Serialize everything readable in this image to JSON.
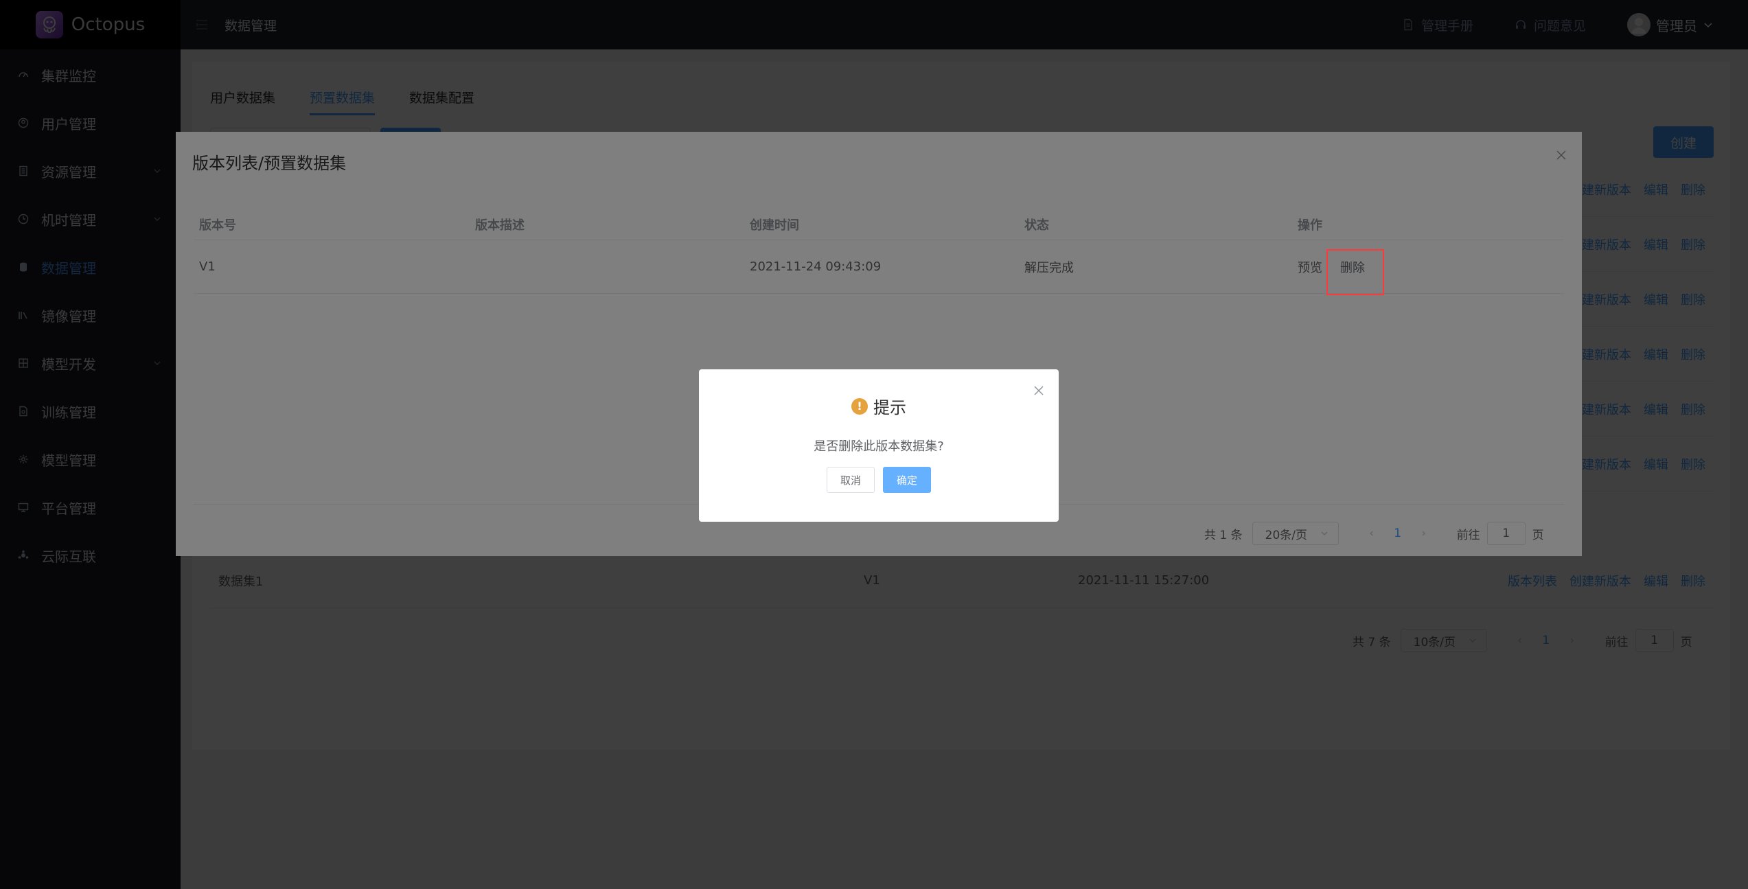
{
  "app": {
    "name": "Octopus"
  },
  "sidebar": {
    "items": [
      {
        "label": "集群监控",
        "icon": "dashboard-icon",
        "active": false,
        "has_children": false
      },
      {
        "label": "用户管理",
        "icon": "user-icon",
        "active": false,
        "has_children": false
      },
      {
        "label": "资源管理",
        "icon": "document-icon",
        "active": false,
        "has_children": true
      },
      {
        "label": "机时管理",
        "icon": "clock-icon",
        "active": false,
        "has_children": true
      },
      {
        "label": "数据管理",
        "icon": "database-icon",
        "active": true,
        "has_children": false
      },
      {
        "label": "镜像管理",
        "icon": "image-icon",
        "active": false,
        "has_children": false
      },
      {
        "label": "模型开发",
        "icon": "grid-icon",
        "active": false,
        "has_children": true
      },
      {
        "label": "训练管理",
        "icon": "file-icon",
        "active": false,
        "has_children": false
      },
      {
        "label": "模型管理",
        "icon": "gear-icon",
        "active": false,
        "has_children": false
      },
      {
        "label": "平台管理",
        "icon": "monitor-icon",
        "active": false,
        "has_children": false
      },
      {
        "label": "云际互联",
        "icon": "network-icon",
        "active": false,
        "has_children": false
      }
    ]
  },
  "header": {
    "breadcrumb": "数据管理",
    "manual": "管理手册",
    "feedback": "问题意见",
    "user": "管理员"
  },
  "main": {
    "tabs": [
      {
        "label": "用户数据集",
        "active": false
      },
      {
        "label": "预置数据集",
        "active": true
      },
      {
        "label": "数据集配置",
        "active": false
      }
    ],
    "create_button": "创建",
    "row_actions": {
      "versions": "版本列表",
      "create_version": "创建新版本",
      "edit": "编辑",
      "delete": "删除"
    },
    "visible_row": {
      "name": "数据集1",
      "version": "V1",
      "time": "2021-11-11 15:27:00"
    },
    "pagination": {
      "total": "共 7 条",
      "page_size": "10条/页",
      "page": "1",
      "goto_prefix": "前往",
      "goto_value": "1",
      "goto_suffix": "页"
    }
  },
  "version_dialog": {
    "title": "版本列表/预置数据集",
    "columns": [
      "版本号",
      "版本描述",
      "创建时间",
      "状态",
      "操作"
    ],
    "rows": [
      {
        "version": "V1",
        "desc": "",
        "time": "2021-11-24 09:43:09",
        "status": "解压完成",
        "preview": "预览",
        "delete": "删除"
      }
    ],
    "pagination": {
      "total": "共 1 条",
      "page_size": "20条/页",
      "page": "1",
      "goto_prefix": "前往",
      "goto_value": "1",
      "goto_suffix": "页"
    }
  },
  "confirm": {
    "title": "提示",
    "message": "是否删除此版本数据集?",
    "cancel": "取消",
    "ok": "确定"
  },
  "colors": {
    "accent": "#409eff",
    "warning": "#e6a23c",
    "highlight": "#ff3a3a",
    "sidebar_bg": "#191a24"
  }
}
